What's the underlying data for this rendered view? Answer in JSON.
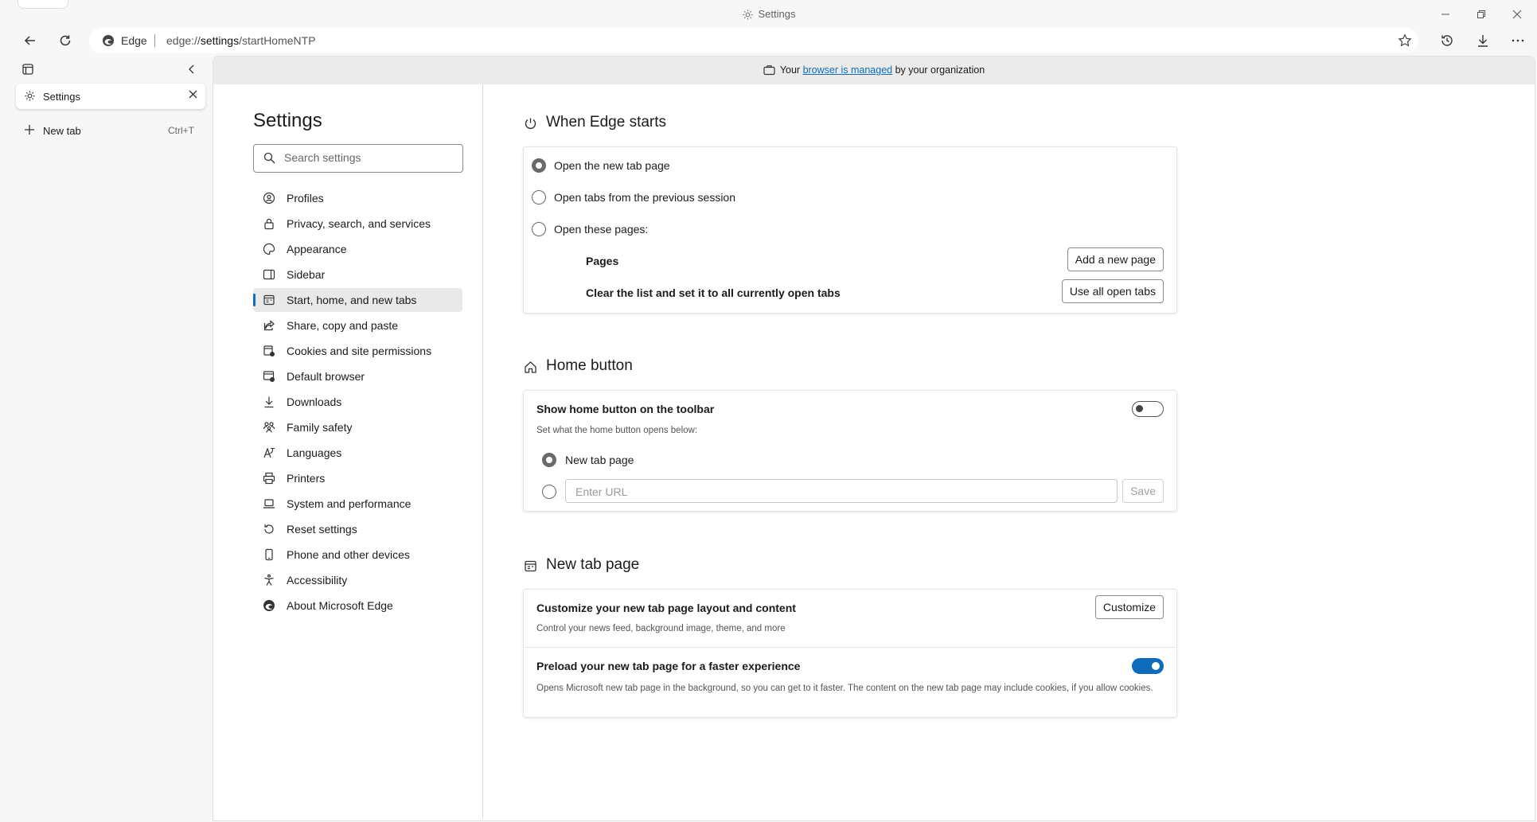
{
  "window": {
    "title": "Settings"
  },
  "toolbar": {
    "edge_label": "Edge",
    "url_prefix": "edge://",
    "url_bold": "settings",
    "url_suffix": "/startHomeNTP"
  },
  "tabs": {
    "items": [
      {
        "label": "Settings",
        "active": true
      },
      {
        "label": "New tab",
        "shortcut": "Ctrl+T"
      }
    ]
  },
  "managed_bar": {
    "prefix": "Your ",
    "link": "browser is managed",
    "suffix": " by your organization"
  },
  "settings_nav": {
    "title": "Settings",
    "search_placeholder": "Search settings",
    "items": [
      {
        "label": "Profiles",
        "icon": "profiles-icon"
      },
      {
        "label": "Privacy, search, and services",
        "icon": "lock-icon"
      },
      {
        "label": "Appearance",
        "icon": "appearance-icon"
      },
      {
        "label": "Sidebar",
        "icon": "sidebar-icon"
      },
      {
        "label": "Start, home, and new tabs",
        "icon": "start-home-icon",
        "active": true
      },
      {
        "label": "Share, copy and paste",
        "icon": "share-icon"
      },
      {
        "label": "Cookies and site permissions",
        "icon": "cookies-icon"
      },
      {
        "label": "Default browser",
        "icon": "default-browser-icon"
      },
      {
        "label": "Downloads",
        "icon": "download-icon"
      },
      {
        "label": "Family safety",
        "icon": "family-icon"
      },
      {
        "label": "Languages",
        "icon": "languages-icon"
      },
      {
        "label": "Printers",
        "icon": "printer-icon"
      },
      {
        "label": "System and performance",
        "icon": "laptop-icon"
      },
      {
        "label": "Reset settings",
        "icon": "reset-icon"
      },
      {
        "label": "Phone and other devices",
        "icon": "phone-icon"
      },
      {
        "label": "Accessibility",
        "icon": "accessibility-icon"
      },
      {
        "label": "About Microsoft Edge",
        "icon": "edge-logo-icon"
      }
    ]
  },
  "when_edge_starts": {
    "title": "When Edge starts",
    "options": [
      {
        "label": "Open the new tab page",
        "selected": true
      },
      {
        "label": "Open tabs from the previous session",
        "selected": false
      },
      {
        "label": "Open these pages:",
        "selected": false
      }
    ],
    "pages_label": "Pages",
    "add_page_button": "Add a new page",
    "clear_label": "Clear the list and set it to all currently open tabs",
    "use_all_button": "Use all open tabs"
  },
  "home_button": {
    "title": "Home button",
    "show_label": "Show home button on the toolbar",
    "show_enabled": false,
    "sub_label": "Set what the home button opens below:",
    "option_new_tab": "New tab page",
    "url_placeholder": "Enter URL",
    "save_button": "Save"
  },
  "new_tab_page": {
    "title": "New tab page",
    "customize_title": "Customize your new tab page layout and content",
    "customize_desc": "Control your news feed, background image, theme, and more",
    "customize_button": "Customize",
    "preload_title": "Preload your new tab page for a faster experience",
    "preload_desc": "Opens Microsoft new tab page in the background, so you can get to it faster. The content on the new tab page may include cookies, if you allow cookies.",
    "preload_enabled": true
  },
  "colors": {
    "accent": "#0f6cbd",
    "nav_active_bg": "#e9e9e9",
    "chrome_bg": "#f7f7f7"
  }
}
